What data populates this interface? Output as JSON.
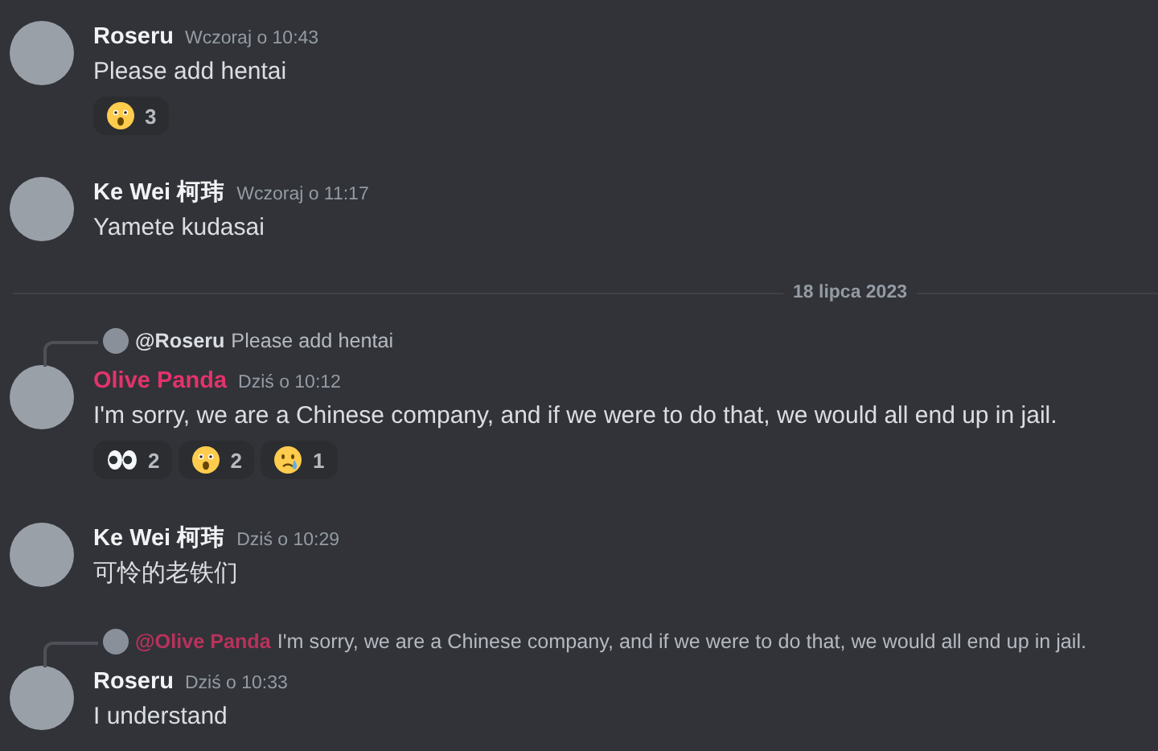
{
  "feed": [
    {
      "kind": "message",
      "author": "Roseru",
      "color": "#f2f3f5",
      "time": "Wczoraj o 10:43",
      "text": "Please add hentai",
      "reactions": [
        {
          "kind": "astonished",
          "count": "3"
        }
      ]
    },
    {
      "kind": "message",
      "author": "Ke Wei 柯玮",
      "color": "#f2f3f5",
      "time": "Wczoraj o 11:17",
      "text": "Yamete kudasai"
    },
    {
      "kind": "divider",
      "label": "18 lipca 2023"
    },
    {
      "kind": "message",
      "reply": {
        "mention": "@Roseru",
        "color": "#dbdee1",
        "text": "Please add hentai"
      },
      "author": "Olive Panda",
      "color": "#e3336b",
      "time": "Dziś o 10:12",
      "text": "I'm sorry, we are a Chinese company, and if we were to do that, we would all end up in jail.",
      "reactions": [
        {
          "kind": "eyes",
          "count": "2"
        },
        {
          "kind": "astonished",
          "count": "2"
        },
        {
          "kind": "tear",
          "count": "1"
        }
      ]
    },
    {
      "kind": "message",
      "author": "Ke Wei 柯玮",
      "color": "#f2f3f5",
      "time": "Dziś o 10:29",
      "text": "可怜的老铁们"
    },
    {
      "kind": "message",
      "reply": {
        "mention": "@Olive Panda",
        "color": "#b8325c",
        "text": "I'm sorry, we are a Chinese company, and if we were to do that, we would all end up in jail."
      },
      "author": "Roseru",
      "color": "#f2f3f5",
      "time": "Dziś o 10:33",
      "text": "I understand"
    }
  ]
}
